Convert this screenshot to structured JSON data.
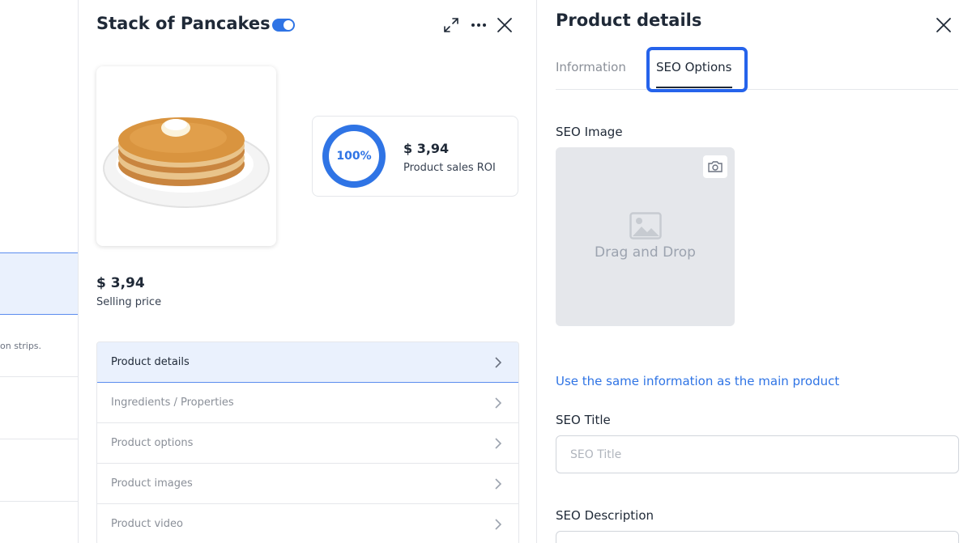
{
  "background": {
    "partial_text": "on strips."
  },
  "product": {
    "title": "Stack of Pancakes",
    "toggle_on": true,
    "roi_percent": "100%",
    "roi_value": "$ 3,94",
    "roi_label": "Product sales ROI",
    "price": "$ 3,94",
    "price_label": "Selling price",
    "menu": [
      {
        "label": "Product details"
      },
      {
        "label": "Ingredients / Properties"
      },
      {
        "label": "Product options"
      },
      {
        "label": "Product images"
      },
      {
        "label": "Product video"
      }
    ]
  },
  "details": {
    "title": "Product details",
    "tabs": [
      {
        "label": "Information"
      },
      {
        "label": "SEO Options"
      }
    ],
    "active_tab": "SEO Options",
    "seo_image_label": "SEO Image",
    "drop_text": "Drag and Drop",
    "same_info_link": "Use the same information as the main product",
    "seo_title_label": "SEO Title",
    "seo_title_placeholder": "SEO Title",
    "seo_title_value": "",
    "seo_description_label": "SEO Description"
  },
  "colors": {
    "accent": "#2f74e5",
    "highlight_border": "#2563eb",
    "active_row_bg": "#eaf1fd"
  },
  "icons": {
    "expand": "expand-icon",
    "more": "more-icon",
    "close": "close-icon",
    "chevron": "chevron-right-icon",
    "camera": "camera-icon",
    "image_placeholder": "image-icon"
  }
}
